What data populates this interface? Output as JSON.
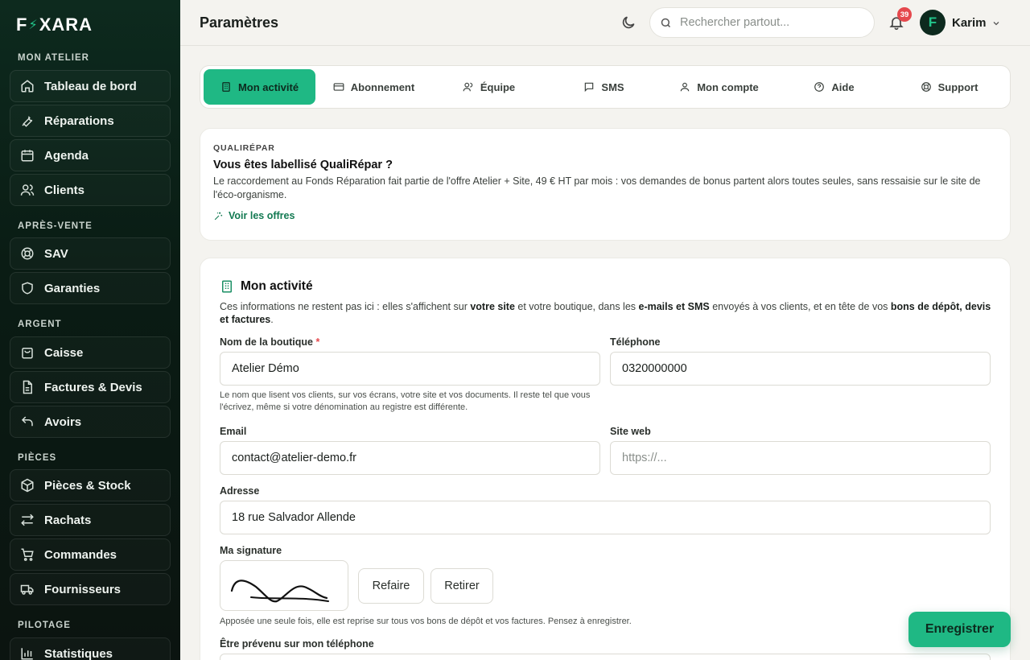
{
  "brand": {
    "logo_left": "F",
    "logo_right": "XARA",
    "bolt": "⚡"
  },
  "sidebar": {
    "sections": [
      {
        "label": "MON ATELIER"
      },
      {
        "label": "APRÈS-VENTE"
      },
      {
        "label": "ARGENT"
      },
      {
        "label": "PIÈCES"
      },
      {
        "label": "PILOTAGE"
      }
    ],
    "items": [
      {
        "label": "Tableau de bord",
        "icon": "home-icon"
      },
      {
        "label": "Réparations",
        "icon": "wrench-icon"
      },
      {
        "label": "Agenda",
        "icon": "calendar-icon"
      },
      {
        "label": "Clients",
        "icon": "users-icon"
      },
      {
        "label": "SAV",
        "icon": "lifebuoy-icon"
      },
      {
        "label": "Garanties",
        "icon": "shield-icon"
      },
      {
        "label": "Caisse",
        "icon": "register-icon"
      },
      {
        "label": "Factures & Devis",
        "icon": "document-icon"
      },
      {
        "label": "Avoirs",
        "icon": "undo-icon"
      },
      {
        "label": "Pièces & Stock",
        "icon": "box-icon"
      },
      {
        "label": "Rachats",
        "icon": "swap-icon"
      },
      {
        "label": "Commandes",
        "icon": "cart-icon"
      },
      {
        "label": "Fournisseurs",
        "icon": "truck-icon"
      },
      {
        "label": "Statistiques",
        "icon": "bar-chart-icon"
      }
    ]
  },
  "header": {
    "title": "Paramètres",
    "search_placeholder": "Rechercher partout...",
    "notifications": "39",
    "avatar_letter": "F",
    "user_name": "Karim"
  },
  "tabs": [
    {
      "label": "Mon activité",
      "icon": "building-icon"
    },
    {
      "label": "Abonnement",
      "icon": "credit-card-icon"
    },
    {
      "label": "Équipe",
      "icon": "team-icon"
    },
    {
      "label": "SMS",
      "icon": "message-icon"
    },
    {
      "label": "Mon compte",
      "icon": "user-icon"
    },
    {
      "label": "Aide",
      "icon": "help-icon"
    },
    {
      "label": "Support",
      "icon": "lifebuoy-icon"
    }
  ],
  "qualirepar": {
    "label": "QUALIRÉPAR",
    "title": "Vous êtes labellisé QualiRépar ?",
    "text": "Le raccordement au Fonds Réparation fait partie de l'offre Atelier + Site, 49 € HT par mois : vos demandes de bonus partent alors toutes seules, sans ressaisie sur le site de l'éco-organisme.",
    "link": "Voir les offres"
  },
  "activity": {
    "title": "Mon activité",
    "desc_1": "Ces informations ne restent pas ici : elles s'affichent sur ",
    "desc_b1": "votre site",
    "desc_2": " et votre boutique, dans les ",
    "desc_b2": "e-mails et SMS",
    "desc_3": " envoyés à vos clients, et en tête de vos ",
    "desc_b3": "bons de dépôt, devis et factures",
    "desc_4": ".",
    "shop_label": "Nom de la boutique",
    "shop_req": "*",
    "shop_value": "Atelier Démo",
    "shop_help": "Le nom que lisent vos clients, sur vos écrans, votre site et vos documents. Il reste tel que vous l'écrivez, même si votre dénomination au registre est différente.",
    "phone_label": "Téléphone",
    "phone_value": "0320000000",
    "email_label": "Email",
    "email_value": "contact@atelier-demo.fr",
    "site_label": "Site web",
    "site_placeholder": "https://...",
    "address_label": "Adresse",
    "address_value": "18 rue Salvador Allende",
    "signature_label": "Ma signature",
    "redo": "Refaire",
    "remove": "Retirer",
    "signature_help": "Apposée une seule fois, elle est reprise sur tous vos bons de dépôt et vos factures. Pensez à enregistrer.",
    "notify_label": "Être prévenu sur mon téléphone"
  },
  "save_label": "Enregistrer"
}
